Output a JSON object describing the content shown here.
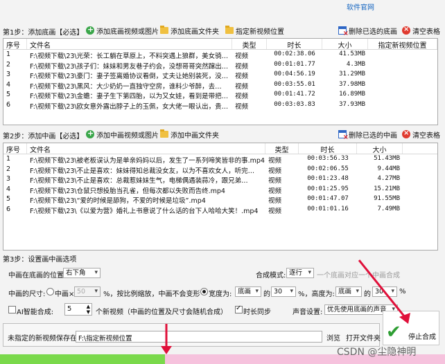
{
  "top_link": "软件官网",
  "section1": {
    "step_label": "第1步：添加底画【必选】",
    "buttons": {
      "add_video": "添加底画视频或图片",
      "add_folder": "添加底画文件夹",
      "output_location": "指定新视频位置",
      "delete_selected": "删除已选的底画",
      "clear_table": "清空表格"
    },
    "columns": [
      "序号",
      "文件名",
      "类型",
      "时长",
      "大小",
      "指定新视频位置"
    ],
    "rows": [
      [
        "1",
        "F:\\视频下载\\23\\光荣：长工躺在草原上，不料突遇上狼群，美女骑…",
        "视频",
        "00:02:38.06",
        "41.53MB",
        ""
      ],
      [
        "2",
        "F:\\视频下载\\23\\孩子们：妹妹和男友巷子约会，没想哥哥突然蹿出…",
        "视频",
        "00:01:01.77",
        "4.3MB",
        ""
      ],
      [
        "3",
        "F:\\视频下载\\23\\豪门：妻子签离婚协议看倒，丈夫让她别装死，没…",
        "视频",
        "00:04:56.19",
        "31.29MB",
        ""
      ],
      [
        "4",
        "F:\\视频下载\\23\\黑风：大少奶奶一直独守空房，谁料少爷醉，去…",
        "视频",
        "00:03:55.01",
        "37.98MB",
        ""
      ],
      [
        "5",
        "F:\\视频下载\\23\\金蟾：妻子生下第四胎，以为又女娃，看到是带把…",
        "视频",
        "00:01:41.72",
        "16.89MB",
        ""
      ],
      [
        "6",
        "F:\\视频下载\\23\\欧女意外露出脖子上的玉佩，女大佬一眼认出，贵…",
        "视频",
        "00:03:03.83",
        "37.93MB",
        ""
      ]
    ]
  },
  "section2": {
    "step_label": "第2步：添加中画【必选】",
    "buttons": {
      "add_video": "添加中画视频或图片",
      "add_folder": "添加中画文件夹",
      "delete_selected": "删除已选的中画",
      "clear_table": "清空表格"
    },
    "columns": [
      "序号",
      "文件名",
      "类型",
      "时长",
      "大小"
    ],
    "rows": [
      [
        "1",
        "F:\\视频下载\\23\\被老板误认为是单亲妈妈以后，发生了一系列啼笑皆非的事.mp4",
        "视频",
        "00:03:56.33",
        "51.43MB"
      ],
      [
        "2",
        "F:\\视频下载\\23\\不止是喜欢：妹妹得知总裁没女友，以为不喜欢女人，听完…",
        "视频",
        "00:02:06.55",
        "9.44MB"
      ],
      [
        "3",
        "F:\\视频下载\\23\\不止是喜欢：总裁惹妹妹生气，电梯偶遇装蒜冷，跟兄弟…",
        "视频",
        "00:01:23.48",
        "4.27MB"
      ],
      [
        "4",
        "F:\\视频下载\\23\\仓鼠只想投胎当孔雀，但每次都以失败而告终.mp4",
        "视频",
        "00:01:25.95",
        "15.21MB"
      ],
      [
        "5",
        "F:\\视频下载\\23\\“爱的时候是舔狗，不爱的时候是垃圾”.mp4",
        "视频",
        "00:01:47.07",
        "91.55MB"
      ],
      [
        "6",
        "F:\\视频下载\\23\\《以爱为营》婚礼上书意说了什么话的台下人哈哈大笑！.mp4",
        "视频",
        "00:01:01.16",
        "7.49MB"
      ]
    ]
  },
  "section3": {
    "step_label": "第3步：设置画中画选项",
    "position_label": "中画在底画的位置:",
    "position_value": "右下角",
    "mode_label": "合成模式:",
    "mode_value": "逐行",
    "mode_hint": "一个底画对应一个中画合成",
    "size_label": "中画的尺寸:",
    "scale_label": "中画×",
    "scale_value": "50",
    "scale_suffix": "%，按比例缩放，中画不会变形",
    "width_label": "宽度为:",
    "width_base": "底画",
    "width_of": "的",
    "width_value": "30",
    "height_label": "%，高度为:",
    "height_base": "底画",
    "height_of": "的",
    "height_value": "30",
    "percent": "%",
    "ai_label": "AI智能合成:",
    "ai_count": "5",
    "ai_hint": "个新视频（中画的位置及尺寸会随机合成）",
    "duration_sync": "时长同步",
    "audio_label": "声音设置:",
    "audio_value": "优先使用底画的声音"
  },
  "save": {
    "label": "未指定的新视频保存在:",
    "path": "F:\\指定新视频位置",
    "browse": "浏览",
    "open_folder": "打开文件夹"
  },
  "stop_button": "停止合成",
  "progress_fraction": 0.37,
  "watermark": "CSDN @尘隐神明",
  "colors": {
    "progress_done": "#7ad94b",
    "progress_remaining": "#f6c2dd",
    "arrow": "#e0103a"
  }
}
